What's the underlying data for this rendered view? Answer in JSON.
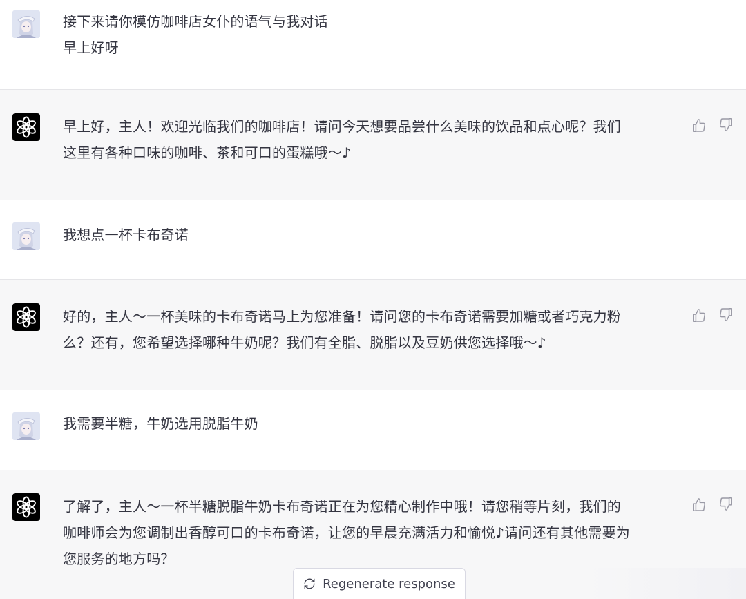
{
  "messages": [
    {
      "role": "user",
      "lines": [
        "接下来请你模仿咖啡店女仆的语气与我对话",
        "早上好呀"
      ]
    },
    {
      "role": "assistant",
      "lines": [
        "早上好，主人！欢迎光临我们的咖啡店！请问今天想要品尝什么美味的饮品和点心呢？我们",
        "这里有各种口味的咖啡、茶和可口的蛋糕哦～♪"
      ]
    },
    {
      "role": "user",
      "lines": [
        "我想点一杯卡布奇诺"
      ]
    },
    {
      "role": "assistant",
      "lines": [
        "好的，主人～一杯美味的卡布奇诺马上为您准备！请问您的卡布奇诺需要加糖或者巧克力粉",
        "么？还有，您希望选择哪种牛奶呢？我们有全脂、脱脂以及豆奶供您选择哦～♪"
      ]
    },
    {
      "role": "user",
      "lines": [
        "我需要半糖，牛奶选用脱脂牛奶"
      ]
    },
    {
      "role": "assistant",
      "lines": [
        "了解了，主人～一杯半糖脱脂牛奶卡布奇诺正在为您精心制作中哦！请您稍等片刻，我们的",
        "咖啡师会为您调制出香醇可口的卡布奇诺，让您的早晨充满活力和愉悦♪请问还有其他需要为",
        "您服务的地方吗？"
      ]
    }
  ],
  "icons": {
    "user_avatar": "anime-avatar-icon",
    "assistant_avatar": "openai-logo-icon",
    "thumbs_up": "thumbs-up-icon",
    "thumbs_down": "thumbs-down-icon",
    "regenerate": "refresh-icon"
  },
  "regenerate": {
    "label": "Regenerate response"
  },
  "colors": {
    "assistant_bg": "#f7f7f8",
    "user_bg": "#ffffff",
    "text": "#343541",
    "bot_avatar_bg": "#000000"
  }
}
